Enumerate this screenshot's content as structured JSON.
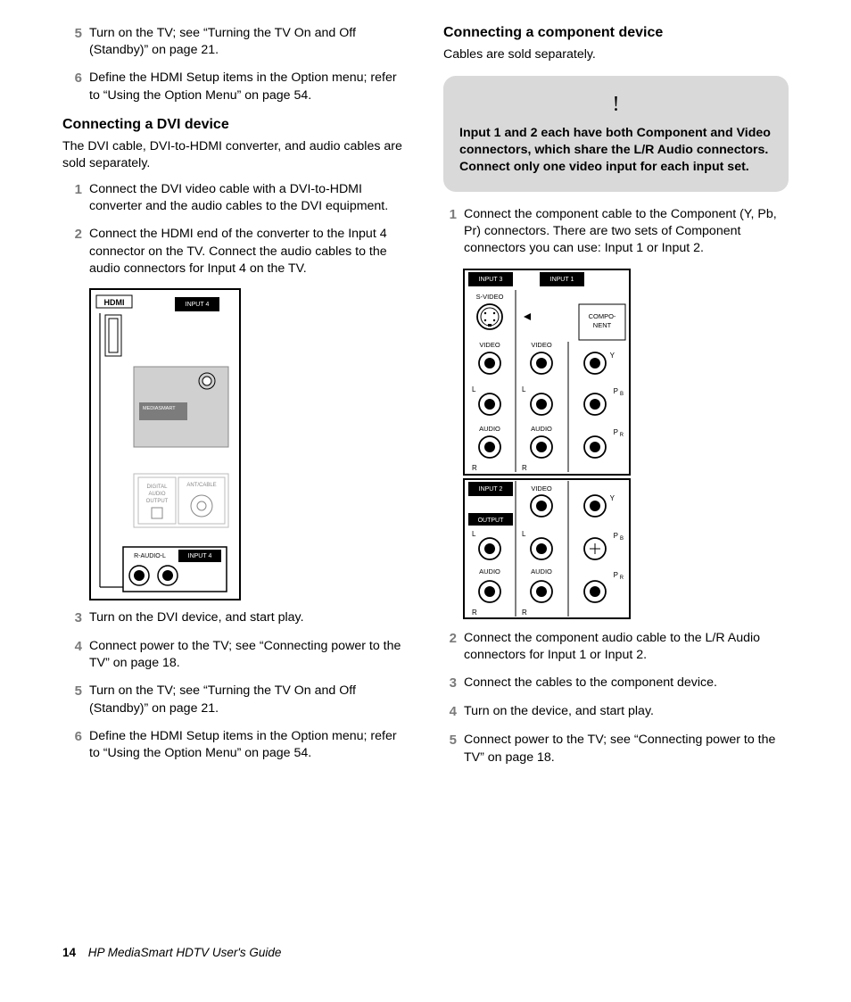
{
  "footer": {
    "page_num": "14",
    "title": "HP MediaSmart HDTV User's Guide"
  },
  "left": {
    "top_steps": [
      {
        "n": "5",
        "t": "Turn on the TV; see “Turning the TV On and Off (Standby)” on page 21."
      },
      {
        "n": "6",
        "t": "Define the HDMI Setup items in the Option menu; refer to “Using the Option Menu” on page 54."
      }
    ],
    "heading": "Connecting a DVI device",
    "intro": "The DVI cable, DVI-to-HDMI converter, and audio cables are sold separately.",
    "steps_a": [
      {
        "n": "1",
        "t": "Connect the DVI video cable with a DVI-to-HDMI converter and the audio cables to the DVI equipment."
      },
      {
        "n": "2",
        "t": "Connect the HDMI end of the converter to the Input 4 connector on the TV. Connect the audio cables to the audio connectors for Input 4 on the TV."
      }
    ],
    "steps_b": [
      {
        "n": "3",
        "t": "Turn on the DVI device, and start play."
      },
      {
        "n": "4",
        "t": "Connect power to the TV; see “Connecting power to the TV” on page 18."
      },
      {
        "n": "5",
        "t": "Turn on the TV; see “Turning the TV On and Off (Standby)” on page 21."
      },
      {
        "n": "6",
        "t": "Define the HDMI Setup items in the Option menu; refer to “Using the Option Menu” on page 54."
      }
    ],
    "diagram": {
      "hdmi": "HDMI",
      "input4": "INPUT 4",
      "mediasmart": "MEDIASMART",
      "digital_audio_output": "DIGITAL\nAUDIO\nOUTPUT",
      "ant_cable": "ANT/CABLE",
      "r_audio_l": "R-AUDIO-L",
      "input4_b": "INPUT 4"
    }
  },
  "right": {
    "heading": "Connecting a component device",
    "intro": "Cables are sold separately.",
    "callout": {
      "bang": "!",
      "text": "Input 1 and 2 each have both Component and Video connectors, which share the L/R Audio connectors. Connect only one video input for each input set."
    },
    "steps_a": [
      {
        "n": "1",
        "t": "Connect the component cable to the Component (Y, Pb, Pr) connectors. There are two sets of Component connectors you can use: Input 1 or Input 2."
      }
    ],
    "steps_b": [
      {
        "n": "2",
        "t": "Connect the component audio cable to the L/R Audio connectors for Input 1 or Input 2."
      },
      {
        "n": "3",
        "t": "Connect the cables to the component device."
      },
      {
        "n": "4",
        "t": "Turn on the device, and start play."
      },
      {
        "n": "5",
        "t": "Connect power to the TV; see “Connecting power to the TV” on page 18."
      }
    ],
    "diagram": {
      "input3": "INPUT 3",
      "input1": "INPUT 1",
      "input2": "INPUT 2",
      "output": "OUTPUT",
      "svideo": "S-VIDEO",
      "video": "VIDEO",
      "component": "COMPO-\nNENT",
      "audio": "AUDIO",
      "L": "L",
      "R": "R",
      "Y": "Y",
      "PB": "PB",
      "PR": "PR"
    }
  }
}
